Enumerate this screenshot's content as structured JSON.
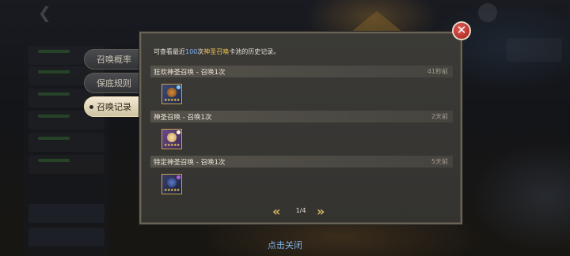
{
  "tabs": [
    {
      "label": "召唤概率",
      "active": false
    },
    {
      "label": "保底规则",
      "active": false
    },
    {
      "label": "召唤记录",
      "active": true
    }
  ],
  "description": {
    "before": "可查看最近",
    "count": "100",
    "mid": "次",
    "pool": "神圣召唤",
    "after": "卡池的历史记录。"
  },
  "records": [
    {
      "title": "狂欢神圣召唤 - 召唤1次",
      "time": "41秒前",
      "hero_icon": "hero-portrait-armored-icon",
      "accent": "#d88a3a"
    },
    {
      "title": "神圣召唤 - 召唤1次",
      "time": "2天前",
      "hero_icon": "hero-portrait-blonde-icon",
      "accent": "#e8c878"
    },
    {
      "title": "特定神圣召唤 - 召唤1次",
      "time": "5天前",
      "hero_icon": "hero-portrait-dark-icon",
      "accent": "#4a7bd0"
    }
  ],
  "pager": {
    "text": "1/4",
    "prev_icon": "double-chevron-left-icon",
    "next_icon": "double-chevron-right-icon"
  },
  "close_icon": "close-x-icon",
  "tap_to_close": "点击关闭",
  "colors": {
    "highlight_blue": "#7fb6ff",
    "highlight_gold": "#f2c14e",
    "close_red": "#c0362f",
    "hint_blue": "#7fb3e8"
  }
}
